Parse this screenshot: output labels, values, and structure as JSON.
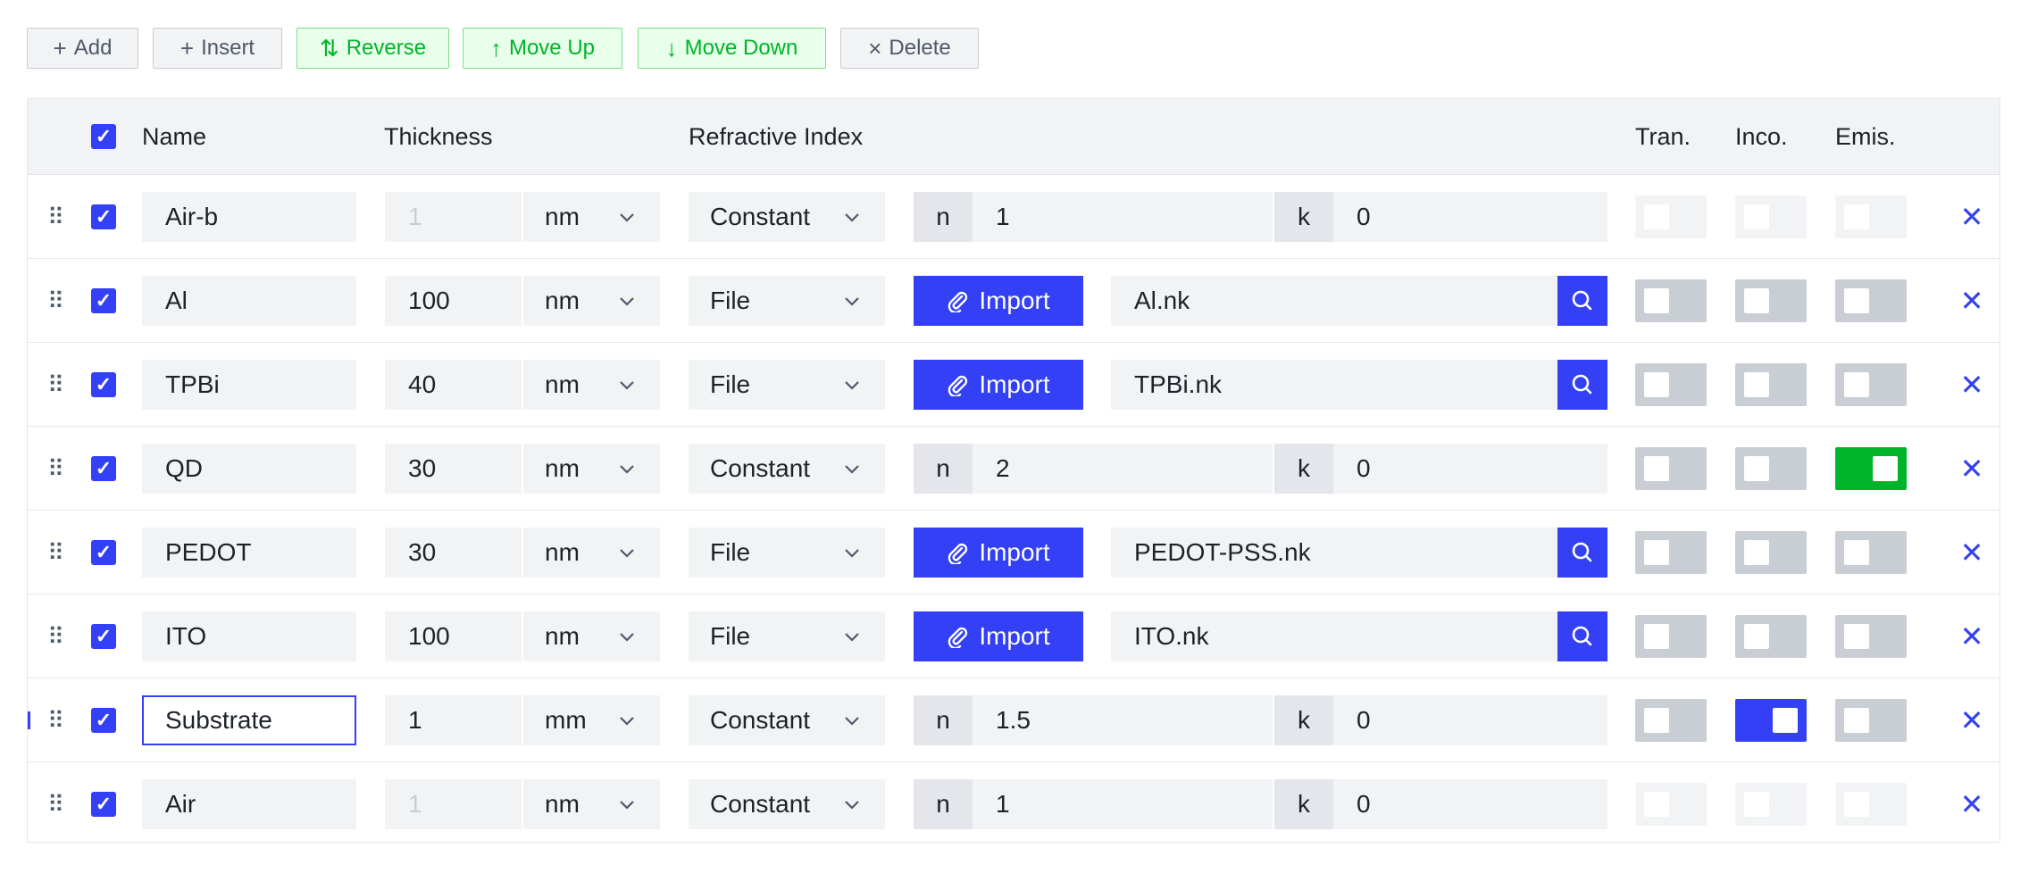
{
  "toolbar": {
    "add": "Add",
    "insert": "Insert",
    "reverse": "Reverse",
    "move_up": "Move Up",
    "move_down": "Move Down",
    "delete": "Delete"
  },
  "headers": {
    "name": "Name",
    "thickness": "Thickness",
    "refractive_index": "Refractive Index",
    "tran": "Tran.",
    "inco": "Inco.",
    "emis": "Emis."
  },
  "labels": {
    "import": "Import",
    "n": "n",
    "k": "k"
  },
  "colors": {
    "accent": "#3340f5",
    "green": "#00b42a",
    "green_bg": "#e8ffea"
  },
  "rows": [
    {
      "name": "Air-b",
      "thickness": "1",
      "unit": "nm",
      "type": "Constant",
      "n": "1",
      "k": "0",
      "file": "",
      "tran": false,
      "inco": false,
      "emis": false,
      "disabled": true
    },
    {
      "name": "Al",
      "thickness": "100",
      "unit": "nm",
      "type": "File",
      "n": "",
      "k": "",
      "file": "Al.nk",
      "tran": false,
      "inco": false,
      "emis": false
    },
    {
      "name": "TPBi",
      "thickness": "40",
      "unit": "nm",
      "type": "File",
      "n": "",
      "k": "",
      "file": "TPBi.nk",
      "tran": false,
      "inco": false,
      "emis": false
    },
    {
      "name": "QD",
      "thickness": "30",
      "unit": "nm",
      "type": "Constant",
      "n": "2",
      "k": "0",
      "file": "",
      "tran": false,
      "inco": false,
      "emis": true
    },
    {
      "name": "PEDOT",
      "thickness": "30",
      "unit": "nm",
      "type": "File",
      "n": "",
      "k": "",
      "file": "PEDOT-PSS.nk",
      "tran": false,
      "inco": false,
      "emis": false
    },
    {
      "name": "ITO",
      "thickness": "100",
      "unit": "nm",
      "type": "File",
      "n": "",
      "k": "",
      "file": "ITO.nk",
      "tran": false,
      "inco": false,
      "emis": false
    },
    {
      "name": "Substrate",
      "thickness": "1",
      "unit": "mm",
      "type": "Constant",
      "n": "1.5",
      "k": "0",
      "file": "",
      "tran": false,
      "inco": true,
      "emis": false,
      "focused": true
    },
    {
      "name": "Air",
      "thickness": "1",
      "unit": "nm",
      "type": "Constant",
      "n": "1",
      "k": "0",
      "file": "",
      "tran": false,
      "inco": false,
      "emis": false,
      "disabled": true
    }
  ]
}
